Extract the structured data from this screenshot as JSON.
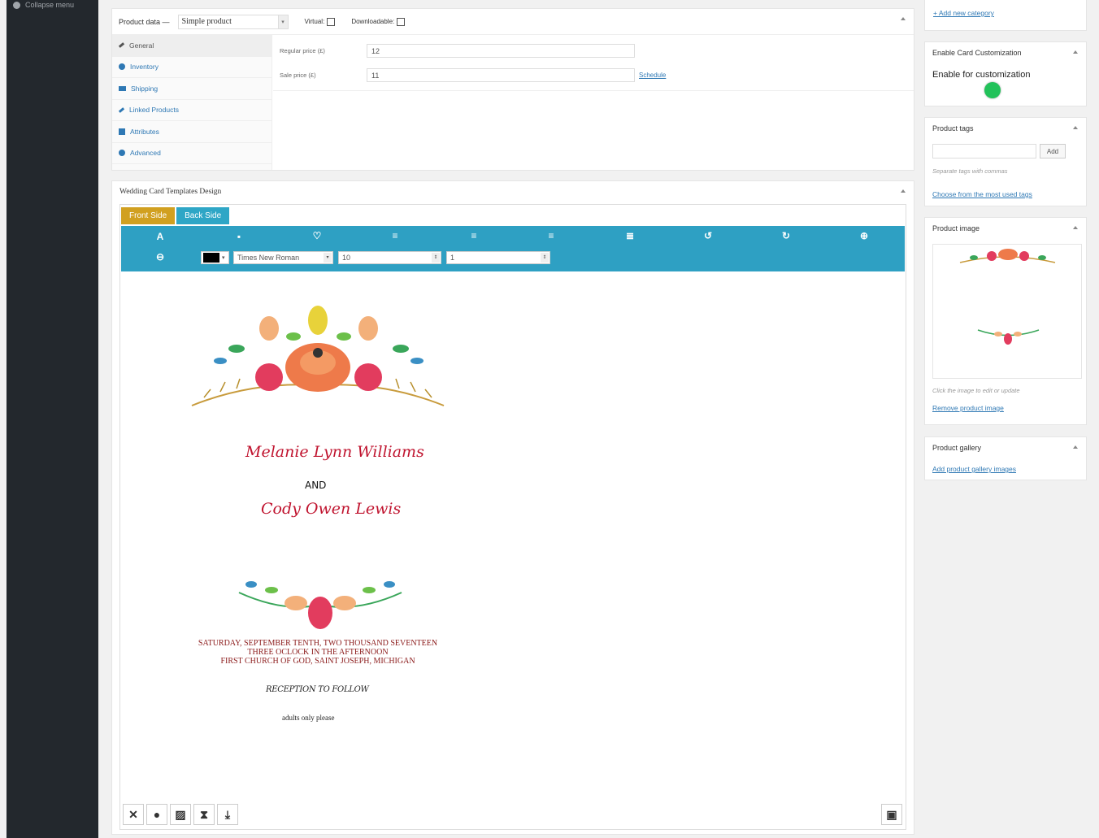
{
  "sidebar": {
    "collapse_label": "Collapse menu"
  },
  "product_data": {
    "label": "Product data —",
    "type_value": "Simple product",
    "virtual_label": "Virtual:",
    "downloadable_label": "Downloadable:",
    "tabs": [
      {
        "label": "General",
        "icon": "wrench-icon"
      },
      {
        "label": "Inventory",
        "icon": "inventory-icon"
      },
      {
        "label": "Shipping",
        "icon": "truck-icon"
      },
      {
        "label": "Linked Products",
        "icon": "link-icon"
      },
      {
        "label": "Attributes",
        "icon": "list-icon"
      },
      {
        "label": "Advanced",
        "icon": "gear-icon"
      }
    ],
    "regular_price_label": "Regular price (£)",
    "regular_price_value": "12",
    "sale_price_label": "Sale price (£)",
    "sale_price_value": "11",
    "schedule_link": "Schedule"
  },
  "wedding": {
    "title": "Wedding Card Templates Design",
    "front_tab": "Front Side",
    "back_tab": "Back Side",
    "font_family": "Times New Roman",
    "font_size": "10",
    "line_height": "1",
    "text_color": "#000000",
    "card": {
      "name1": "Melanie Lynn Williams",
      "and": "AND",
      "name2": "Cody Owen Lewis",
      "details": [
        "SATURDAY, SEPTEMBER TENTH, TWO THOUSAND SEVENTEEN",
        "THREE OCLOCK IN THE AFTERNOON",
        "FIRST CHURCH OF GOD, SAINT JOSEPH, MICHIGAN"
      ],
      "reception": "RECEPTION TO FOLLOW",
      "adults": "adults only please"
    }
  },
  "right": {
    "add_category_link": "+ Add new category",
    "customization_title": "Enable Card Customization",
    "customization_label": "Enable for customization",
    "toggle_color": "#22c25a",
    "tags_title": "Product tags",
    "tags_add": "Add",
    "tags_hint": "Separate tags with commas",
    "tags_link": "Choose from the most used tags",
    "image_title": "Product image",
    "image_hint": "Click the image to edit or update",
    "image_remove": "Remove product image",
    "gallery_title": "Product gallery",
    "gallery_link": "Add product gallery images"
  },
  "colors": {
    "toolbar": "#2ea0c3",
    "front_tab": "#d1a020",
    "back_tab": "#2ea6c6",
    "sidebar": "#23282d"
  }
}
